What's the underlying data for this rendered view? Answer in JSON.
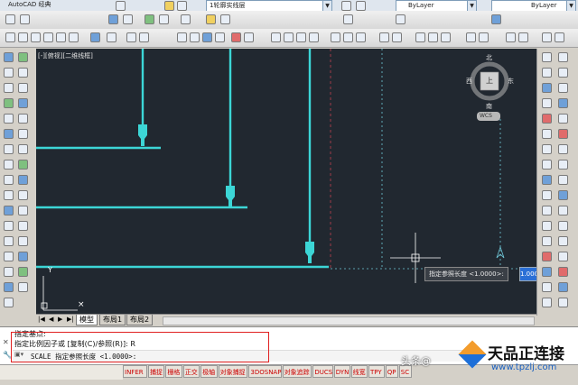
{
  "toolbar": {
    "workspace": "AutoCAD 经典",
    "layer_combo": "1轮廓实线层",
    "color_combo": "ByLayer",
    "linetype_combo": "ByLayer"
  },
  "viewport": {
    "label": "[-][俯视][二维线框]",
    "viewcube_north": "北",
    "viewcube_south": "南",
    "viewcube_west": "西",
    "viewcube_east": "东",
    "viewcube_top": "上",
    "wcs": "WCS",
    "tooltip_prompt": "指定参照长度 <1.0000>:",
    "tooltip_input": "1.0000"
  },
  "layout_tabs": [
    "模型",
    "布局1",
    "布局2"
  ],
  "command": {
    "history_line1": "指定基点:",
    "history_line2": "指定比例因子或 [复制(C)/参照(R)]: R",
    "current_prompt": "SCALE 指定参照长度 <1.0000>:"
  },
  "status_buttons": [
    "INFER",
    "捕捉",
    "栅格",
    "正交",
    "极轴",
    "对象捕捉",
    "3DOSNAP",
    "对象追踪",
    "DUCS",
    "DYN",
    "线宽",
    "TPY",
    "QP",
    "SC"
  ],
  "watermark": {
    "brand": "天品正连接",
    "url": "www.tpzlj.com",
    "headline_prefix": "头条@"
  },
  "colors": {
    "canvas_bg": "#212830",
    "geometry": "#3cd6d6",
    "highlight_box": "#e02020"
  }
}
